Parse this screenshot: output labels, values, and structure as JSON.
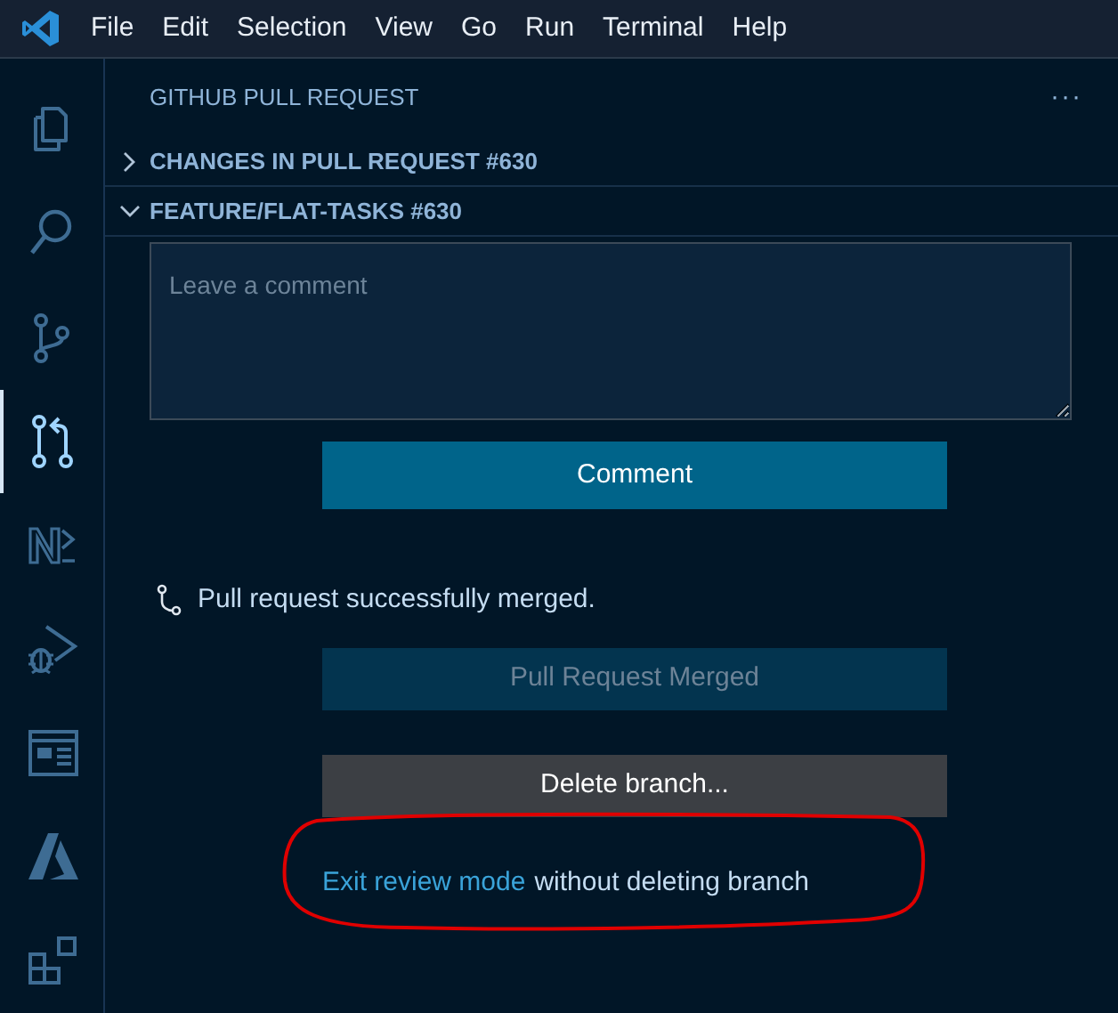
{
  "menu": [
    "File",
    "Edit",
    "Selection",
    "View",
    "Go",
    "Run",
    "Terminal",
    "Help"
  ],
  "activity_bar": [
    {
      "kind": "files",
      "selected": false
    },
    {
      "kind": "search",
      "selected": false
    },
    {
      "kind": "branch",
      "selected": false
    },
    {
      "kind": "pull-request",
      "selected": true
    },
    {
      "kind": "n2",
      "selected": false
    },
    {
      "kind": "debug",
      "selected": false
    },
    {
      "kind": "window",
      "selected": false
    },
    {
      "kind": "azure",
      "selected": false
    },
    {
      "kind": "extensions",
      "selected": false
    }
  ],
  "panel": {
    "title": "GITHUB PULL REQUEST",
    "more": "···",
    "sections": [
      {
        "label": "CHANGES IN PULL REQUEST #630",
        "expanded": false
      },
      {
        "label": "FEATURE/FLAT-TASKS #630",
        "expanded": true
      }
    ],
    "comment_box": {
      "placeholder": "Leave a comment"
    },
    "comment_button": "Comment",
    "status": "Pull request successfully merged.",
    "merged_button": {
      "label": "Pull Request Merged",
      "disabled": true
    },
    "delete_button": {
      "label": "Delete branch...",
      "disabled": false
    },
    "exit": {
      "link": "Exit review mode",
      "text": "without deleting branch",
      "circled": true
    }
  }
}
